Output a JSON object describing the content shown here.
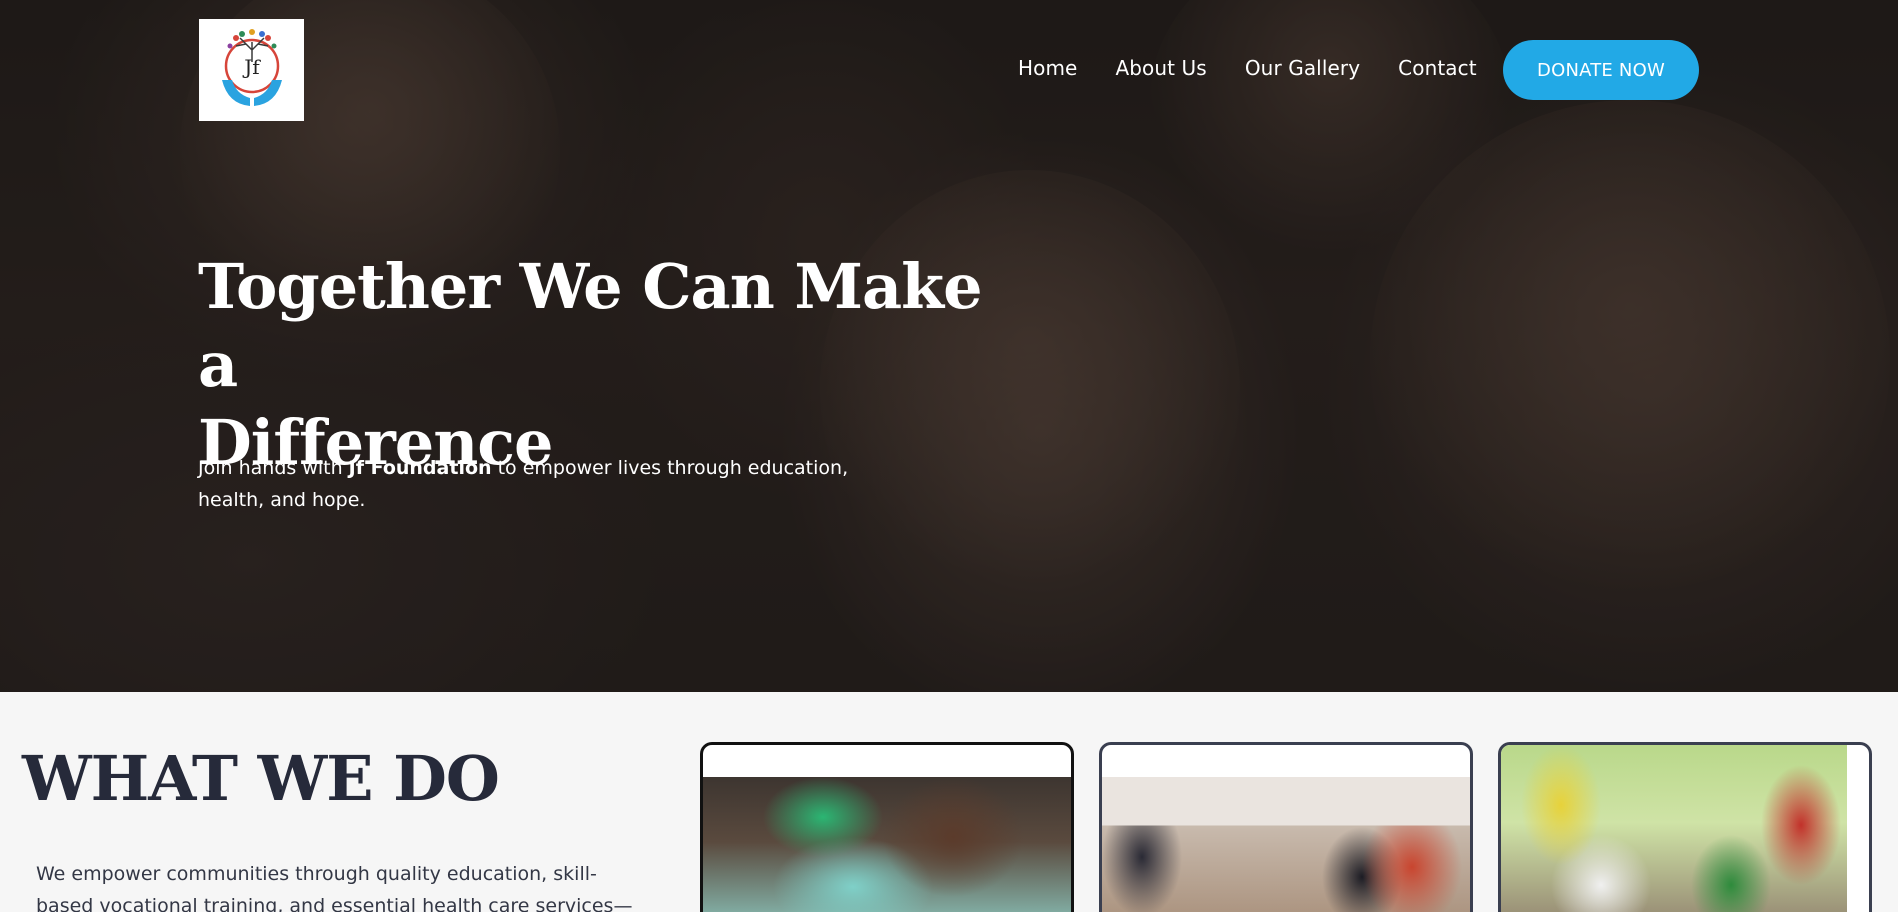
{
  "logo": {
    "text": "Jf"
  },
  "nav": {
    "items": [
      {
        "label": "Home"
      },
      {
        "label": "About Us"
      },
      {
        "label": "Our Gallery"
      },
      {
        "label": "Contact"
      }
    ],
    "donate_label": "DONATE NOW"
  },
  "hero": {
    "title_line1": "Together We Can Make a",
    "title_line2": "Difference",
    "subtitle_before": "Join hands with ",
    "subtitle_strong": "Jf Foundation",
    "subtitle_after": " to empower lives through education, health, and hope."
  },
  "what_we_do": {
    "title": "WHAT WE DO",
    "text": "We empower communities through quality education, skill-based vocational training, and essential health care services—"
  },
  "colors": {
    "accent": "#22a9e6",
    "heading_dark": "#262a3a",
    "section_bg": "#f6f6f6"
  }
}
